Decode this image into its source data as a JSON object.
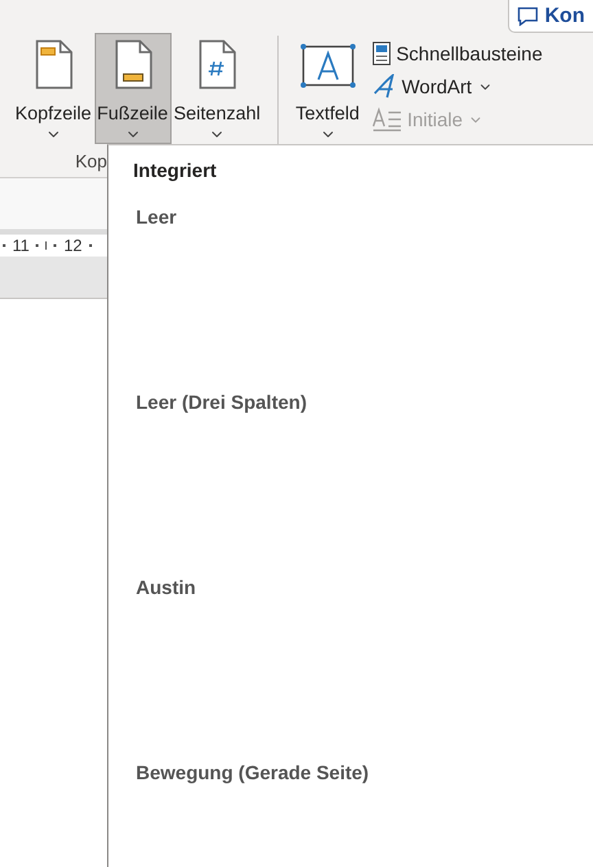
{
  "comment_button": {
    "label": "Kon"
  },
  "ribbon": {
    "large_buttons": [
      {
        "label": "Kopfzeile",
        "kind": "header",
        "selected": false
      },
      {
        "label": "Fußzeile",
        "kind": "footer",
        "selected": true
      },
      {
        "label": "Seitenzahl",
        "kind": "pagenumber",
        "selected": false
      },
      {
        "label": "Textfeld",
        "kind": "textbox",
        "selected": false
      }
    ],
    "small_buttons": [
      {
        "label": "Schnellbausteine",
        "kind": "quickparts",
        "disabled": false,
        "caret": false
      },
      {
        "label": "WordArt",
        "kind": "wordart",
        "disabled": false,
        "caret": true
      },
      {
        "label": "Initiale",
        "kind": "dropcap",
        "disabled": true,
        "caret": true
      }
    ],
    "group_label": "Kop"
  },
  "ruler": {
    "labels": [
      "11",
      "12"
    ]
  },
  "dropdown": {
    "heading": "Integriert",
    "items": [
      {
        "label": "Leer"
      },
      {
        "label": "Leer (Drei Spalten)"
      },
      {
        "label": "Austin"
      },
      {
        "label": "Bewegung (Gerade Seite)"
      }
    ]
  }
}
